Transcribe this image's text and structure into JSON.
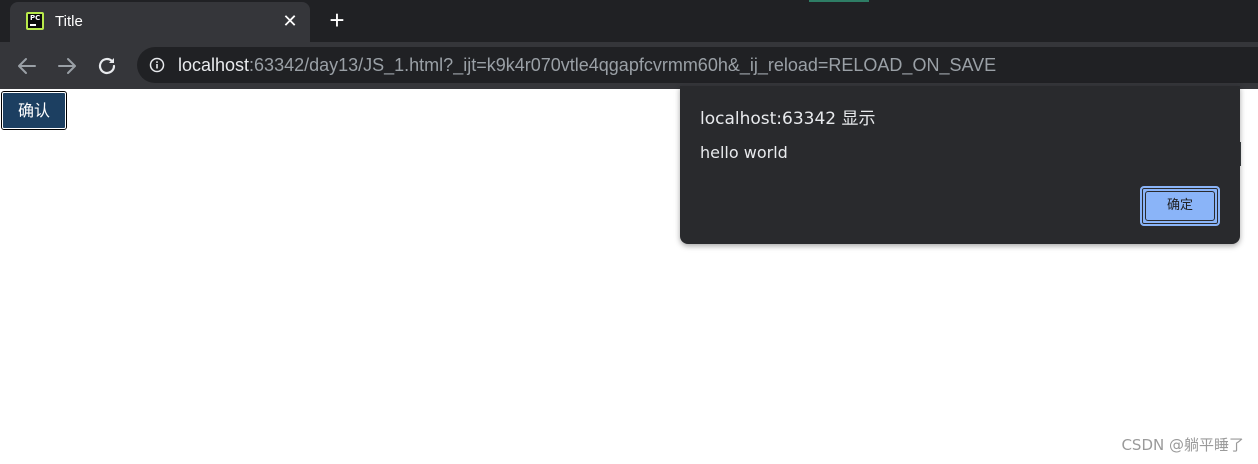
{
  "tab": {
    "title": "Title",
    "favicon": "pycharm-icon",
    "close_label": "✕",
    "new_tab_label": "+"
  },
  "toolbar": {
    "back_icon": "arrow-left-icon",
    "forward_icon": "arrow-right-icon",
    "reload_icon": "reload-icon",
    "site_info_icon": "info-circle-icon",
    "url_host": "localhost",
    "url_rest": ":63342/day13/JS_1.html?_ijt=k9k4r070vtle4qgapfcvrmm60h&_ij_reload=RELOAD_ON_SAVE"
  },
  "page": {
    "confirm_button_label": "确认"
  },
  "dialog": {
    "title": "localhost:63342 显示",
    "message": "hello world",
    "ok_label": "确定"
  },
  "watermark": "CSDN @躺平睡了",
  "colors": {
    "chrome_bg": "#202124",
    "toolbar_bg": "#35363a",
    "dialog_bg": "#292a2d",
    "ok_button": "#8ab4f8",
    "confirm_button": "#1c3f61"
  }
}
